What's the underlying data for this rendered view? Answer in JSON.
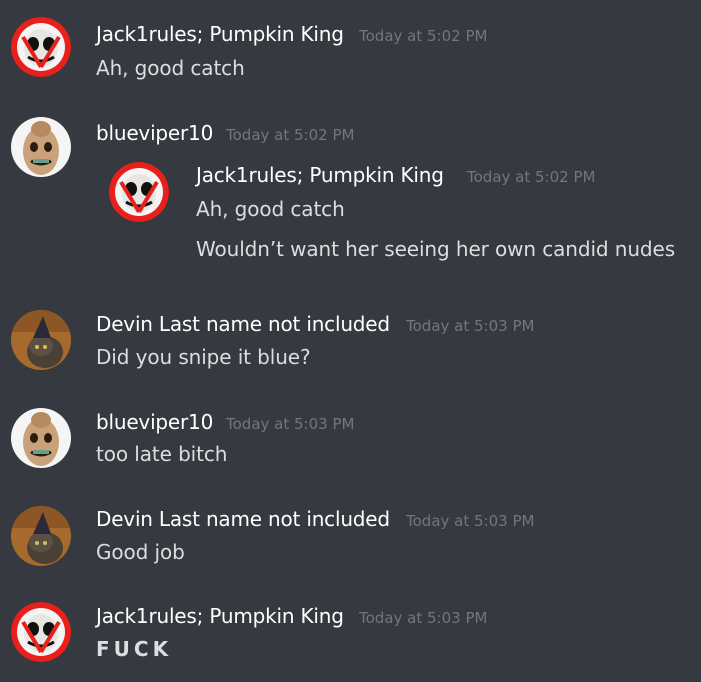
{
  "messages": [
    {
      "author": "Jack1rules; Pumpkin King",
      "timestamp": "Today at 5:02 PM",
      "lines": [
        "Ah, good catch"
      ],
      "avatar": "pumpkin-king-avatar"
    },
    {
      "author": "blueviper10",
      "timestamp": "Today at 5:02 PM",
      "lines": [],
      "avatar": "oogie-boogie-avatar",
      "quote": {
        "author": "Jack1rules; Pumpkin King",
        "timestamp": "Today at 5:02 PM",
        "lines": [
          "Ah, good catch",
          "Wouldn’t want her seeing her own candid nudes"
        ],
        "avatar": "pumpkin-king-avatar"
      }
    },
    {
      "author": "Devin Last name not included",
      "timestamp": "Today at 5:03 PM",
      "lines": [
        "Did you snipe it blue?"
      ],
      "avatar": "cat-witch-hat-avatar"
    },
    {
      "author": "blueviper10",
      "timestamp": "Today at 5:03 PM",
      "lines": [
        "too late bitch"
      ],
      "avatar": "oogie-boogie-avatar"
    },
    {
      "author": "Devin Last name not included",
      "timestamp": "Today at 5:03 PM",
      "lines": [
        "Good job"
      ],
      "avatar": "cat-witch-hat-avatar"
    },
    {
      "author": "Jack1rules; Pumpkin King",
      "timestamp": "Today at 5:03 PM",
      "lines": [
        "FUCK"
      ],
      "avatar": "pumpkin-king-avatar"
    }
  ],
  "colors": {
    "background": "#36393f",
    "username": "#ffffff",
    "timestamp": "#72767d",
    "text": "#dcddde",
    "red_ring": "#e8201c"
  }
}
